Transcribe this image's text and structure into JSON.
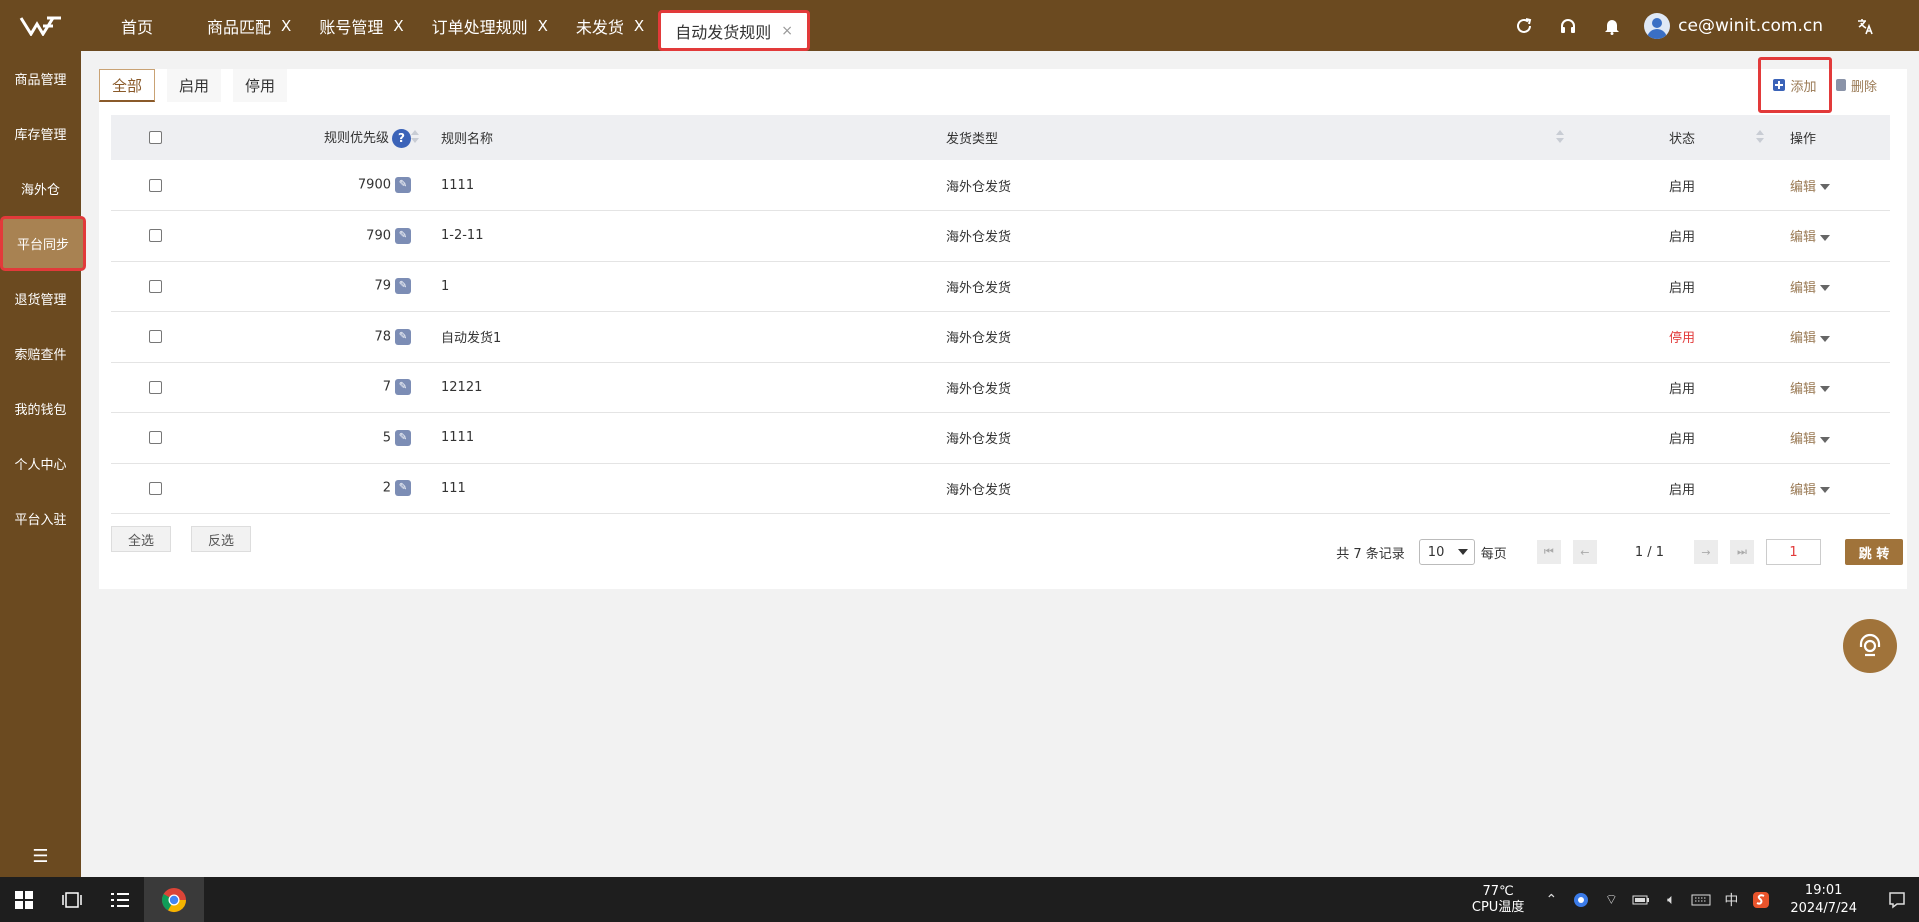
{
  "topbar": {
    "tabs": [
      {
        "label": "首页",
        "closable": false
      },
      {
        "label": "商品匹配",
        "closable": true
      },
      {
        "label": "账号管理",
        "closable": true
      },
      {
        "label": "订单处理规则",
        "closable": true
      },
      {
        "label": "未发货",
        "closable": true
      },
      {
        "label": "自动发货规则",
        "closable": true,
        "active": true
      }
    ],
    "close_glyph": "X",
    "user_email": "ce@winit.com.cn"
  },
  "sidebar": {
    "items": [
      "商品管理",
      "库存管理",
      "海外仓",
      "平台同步",
      "退货管理",
      "索赔查件",
      "我的钱包",
      "个人中心",
      "平台入驻"
    ],
    "active_index": 3,
    "toggle_glyph": "☰"
  },
  "filter_tabs": [
    "全部",
    "启用",
    "停用"
  ],
  "actions": {
    "add_label": "添加",
    "delete_label": "删除"
  },
  "table": {
    "headers": {
      "priority": "规则优先级",
      "name": "规则名称",
      "type": "发货类型",
      "status": "状态",
      "op": "操作"
    },
    "help_glyph": "?",
    "rows": [
      {
        "priority": "7900",
        "name": "1111",
        "type": "海外仓发货",
        "status": "启用",
        "op": "编辑"
      },
      {
        "priority": "790",
        "name": "1-2-11",
        "type": "海外仓发货",
        "status": "启用",
        "op": "编辑"
      },
      {
        "priority": "79",
        "name": "1",
        "type": "海外仓发货",
        "status": "启用",
        "op": "编辑"
      },
      {
        "priority": "78",
        "name": "自动发货1",
        "type": "海外仓发货",
        "status": "停用",
        "op": "编辑"
      },
      {
        "priority": "7",
        "name": "12121",
        "type": "海外仓发货",
        "status": "启用",
        "op": "编辑"
      },
      {
        "priority": "5",
        "name": "1111",
        "type": "海外仓发货",
        "status": "启用",
        "op": "编辑"
      },
      {
        "priority": "2",
        "name": "111",
        "type": "海外仓发货",
        "status": "启用",
        "op": "编辑"
      }
    ]
  },
  "bottom": {
    "select_all": "全选",
    "invert": "反选"
  },
  "pager": {
    "total_text": "共 7 条记录",
    "page_size": "10",
    "per_page": "每页",
    "page_info": "1 / 1",
    "jump_value": "1",
    "jump_label": "跳 转"
  },
  "taskbar": {
    "temp": "77℃",
    "temp_label": "CPU温度",
    "ime": "中",
    "time": "19:01",
    "date": "2024/7/24"
  },
  "colors": {
    "brand": "#6b4a20",
    "accent": "#a0733a",
    "disabled": "#e23a3a"
  }
}
